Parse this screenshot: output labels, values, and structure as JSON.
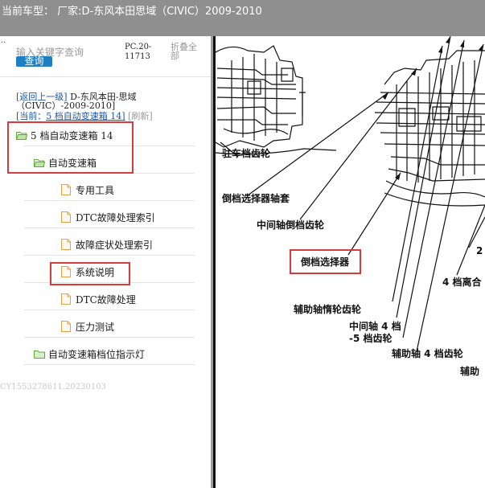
{
  "title_bar": {
    "text": "当前车型：  厂家:D-东风本田思域（CIVIC）2009-2010"
  },
  "left_panel": {
    "stray_mark": "..",
    "search": {
      "placeholder": "输入关键字查询",
      "button_label": "查询"
    },
    "pc_code": "PC.20-11713",
    "collapse_all": "折叠全部",
    "back_link_text": "[返回上一级]",
    "back_model": "D-东风本田-思域（CIVIC）-2009-2010]",
    "current_label": "[当前：",
    "current_path": "5 档自动变速箱 14]",
    "refresh": "[刷新]",
    "tree": [
      {
        "label": "5 档自动变速箱 14",
        "icon": "folder-open-icon"
      },
      {
        "label": "自动变速箱",
        "icon": "folder-open-icon"
      },
      {
        "label": "专用工具",
        "icon": "page-icon"
      },
      {
        "label": "DTC故障处理索引",
        "icon": "page-icon"
      },
      {
        "label": "故障症状处理索引",
        "icon": "page-icon"
      },
      {
        "label": "系统说明",
        "icon": "page-icon"
      },
      {
        "label": "DTC故障处理",
        "icon": "page-icon"
      },
      {
        "label": "压力测试",
        "icon": "page-icon"
      },
      {
        "label": "自动变速箱档位指示灯",
        "icon": "folder-icon"
      }
    ],
    "watermark": "CY1553278611.20230103"
  },
  "diagram": {
    "labels": [
      "驻车档齿轮",
      "倒档选择器轴套",
      "中间轴倒档齿轮",
      "倒档选择器",
      "辅助轴惰轮齿轮",
      "中间轴 4 档",
      "-5 档齿轮",
      "辅助轴 4 档齿轮",
      "辅助",
      "2",
      "4 档离合"
    ]
  },
  "colors": {
    "title_bar_bg": "#8f8f8f",
    "highlight_red": "#d93a3a",
    "search_button_blue": "#1f7fc4",
    "folder_green": "#5cab3a",
    "page_icon_orange": "#e6a24a"
  }
}
